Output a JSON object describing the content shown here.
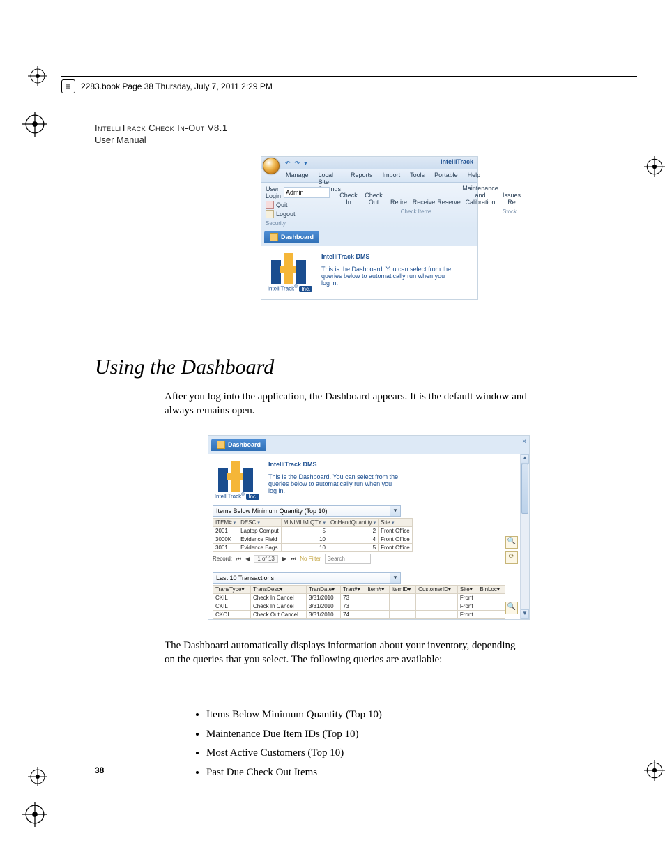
{
  "book_header": {
    "text": "2283.book  Page 38  Thursday, July 7, 2011  2:29 PM"
  },
  "doc_header": {
    "product_line": "IntelliTrack Check In-Out V8.1",
    "subtitle": "User Manual"
  },
  "section_heading": "Using the Dashboard",
  "para1": "After you log into the application, the Dashboard appears. It is the default window and always remains open.",
  "para2": "The Dashboard  automatically displays information about your inventory, depending on the queries that you select. The following queries are available:",
  "bullets": [
    "Items Below Minimum Quantity (Top 10)",
    "Maintenance Due Item IDs (Top 10)",
    "Most Active Customers (Top 10)",
    "Past Due Check Out Items"
  ],
  "page_number": "38",
  "app": {
    "brand": "IntelliTrack",
    "tabs": [
      "Manage",
      "Local Site Settings",
      "Reports",
      "Import",
      "Tools",
      "Portable",
      "Help"
    ],
    "login_label": "User Login",
    "login_value": "Admin",
    "quit": "Quit",
    "logout": "Logout",
    "security_group": "Security",
    "check_buttons": [
      "Check In",
      "Check Out",
      "Retire",
      "Receive",
      "Reserve"
    ],
    "maint_button": "Maintenance and Calibration",
    "issues_button": "Issues  Re",
    "check_group": "Check Items",
    "stock_group": "Stock",
    "dashboard_tab": "Dashboard",
    "dash_heading": "IntelliTrack DMS",
    "dash_msg": "This is the Dashboard.  You can select from the queries below to automatically run when you log in.",
    "logo_caption_a": "IntelliTrack",
    "logo_caption_b": "Inc."
  },
  "fig2": {
    "dropdown1": "Items Below Minimum Quantity (Top 10)",
    "table1": {
      "cols": [
        "ITEM#",
        "DESC",
        "MINIMUM QTY",
        "OnHandQuantity",
        "Site"
      ],
      "rows": [
        [
          "2001",
          "Laptop Comput",
          "5",
          "2",
          "Front Office"
        ],
        [
          "3000K",
          "Evidence Field",
          "10",
          "4",
          "Front Office"
        ],
        [
          "3001",
          "Evidence Bags",
          "10",
          "5",
          "Front Office"
        ]
      ]
    },
    "recnav": {
      "label": "Record:",
      "pos": "1 of 13",
      "nofilter": "No Filter",
      "search": "Search"
    },
    "dropdown2": "Last 10 Transactions",
    "table2": {
      "cols": [
        "TransType",
        "TransDesc",
        "TranDate",
        "Tran#",
        "Item#",
        "ItemID",
        "CustomerID",
        "Site",
        "BinLoc"
      ],
      "rows": [
        [
          "CKIL",
          "Check In Cancel",
          "3/31/2010",
          "73",
          "",
          "",
          "",
          "Front",
          ""
        ],
        [
          "CKIL",
          "Check In Cancel",
          "3/31/2010",
          "73",
          "",
          "",
          "",
          "Front",
          ""
        ],
        [
          "CKOI",
          "Check Out Cancel",
          "3/31/2010",
          "74",
          "",
          "",
          "",
          "Front",
          ""
        ]
      ]
    }
  },
  "chart_data": {
    "type": "table",
    "title": "Items Below Minimum Quantity (Top 10)",
    "columns": [
      "ITEM#",
      "DESC",
      "MINIMUM QTY",
      "OnHandQuantity",
      "Site"
    ],
    "rows": [
      [
        "2001",
        "Laptop Comput",
        5,
        2,
        "Front Office"
      ],
      [
        "3000K",
        "Evidence Field",
        10,
        4,
        "Front Office"
      ],
      [
        "3001",
        "Evidence Bags",
        10,
        5,
        "Front Office"
      ]
    ]
  }
}
